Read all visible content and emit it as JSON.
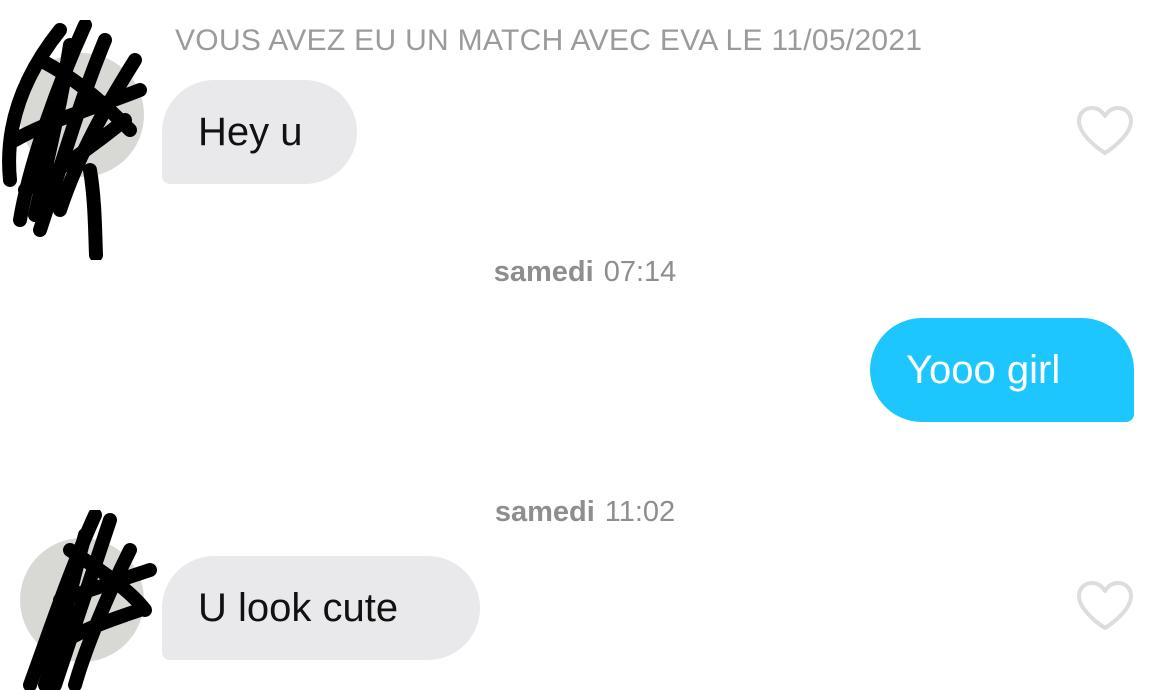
{
  "conversation": {
    "match_banner": "VOUS AVEZ EU UN MATCH AVEC EVA LE 11/05/2021",
    "messages": [
      {
        "side": "received",
        "text": "Hey u"
      },
      {
        "day": "samedi",
        "time": "07:14"
      },
      {
        "side": "sent",
        "text": "Yooo girl"
      },
      {
        "day": "samedi",
        "time": "11:02"
      },
      {
        "side": "received",
        "text": "U look cute"
      }
    ]
  },
  "icons": {
    "avatar": "redacted-avatar-icon",
    "like": "heart-outline-icon"
  },
  "colors": {
    "received_bubble": "#e9e9eb",
    "sent_bubble": "#1ec6ff",
    "timestamp_text": "#8e8e8e",
    "banner_text": "#9b9b9b",
    "heart_outline": "#dddddd"
  }
}
